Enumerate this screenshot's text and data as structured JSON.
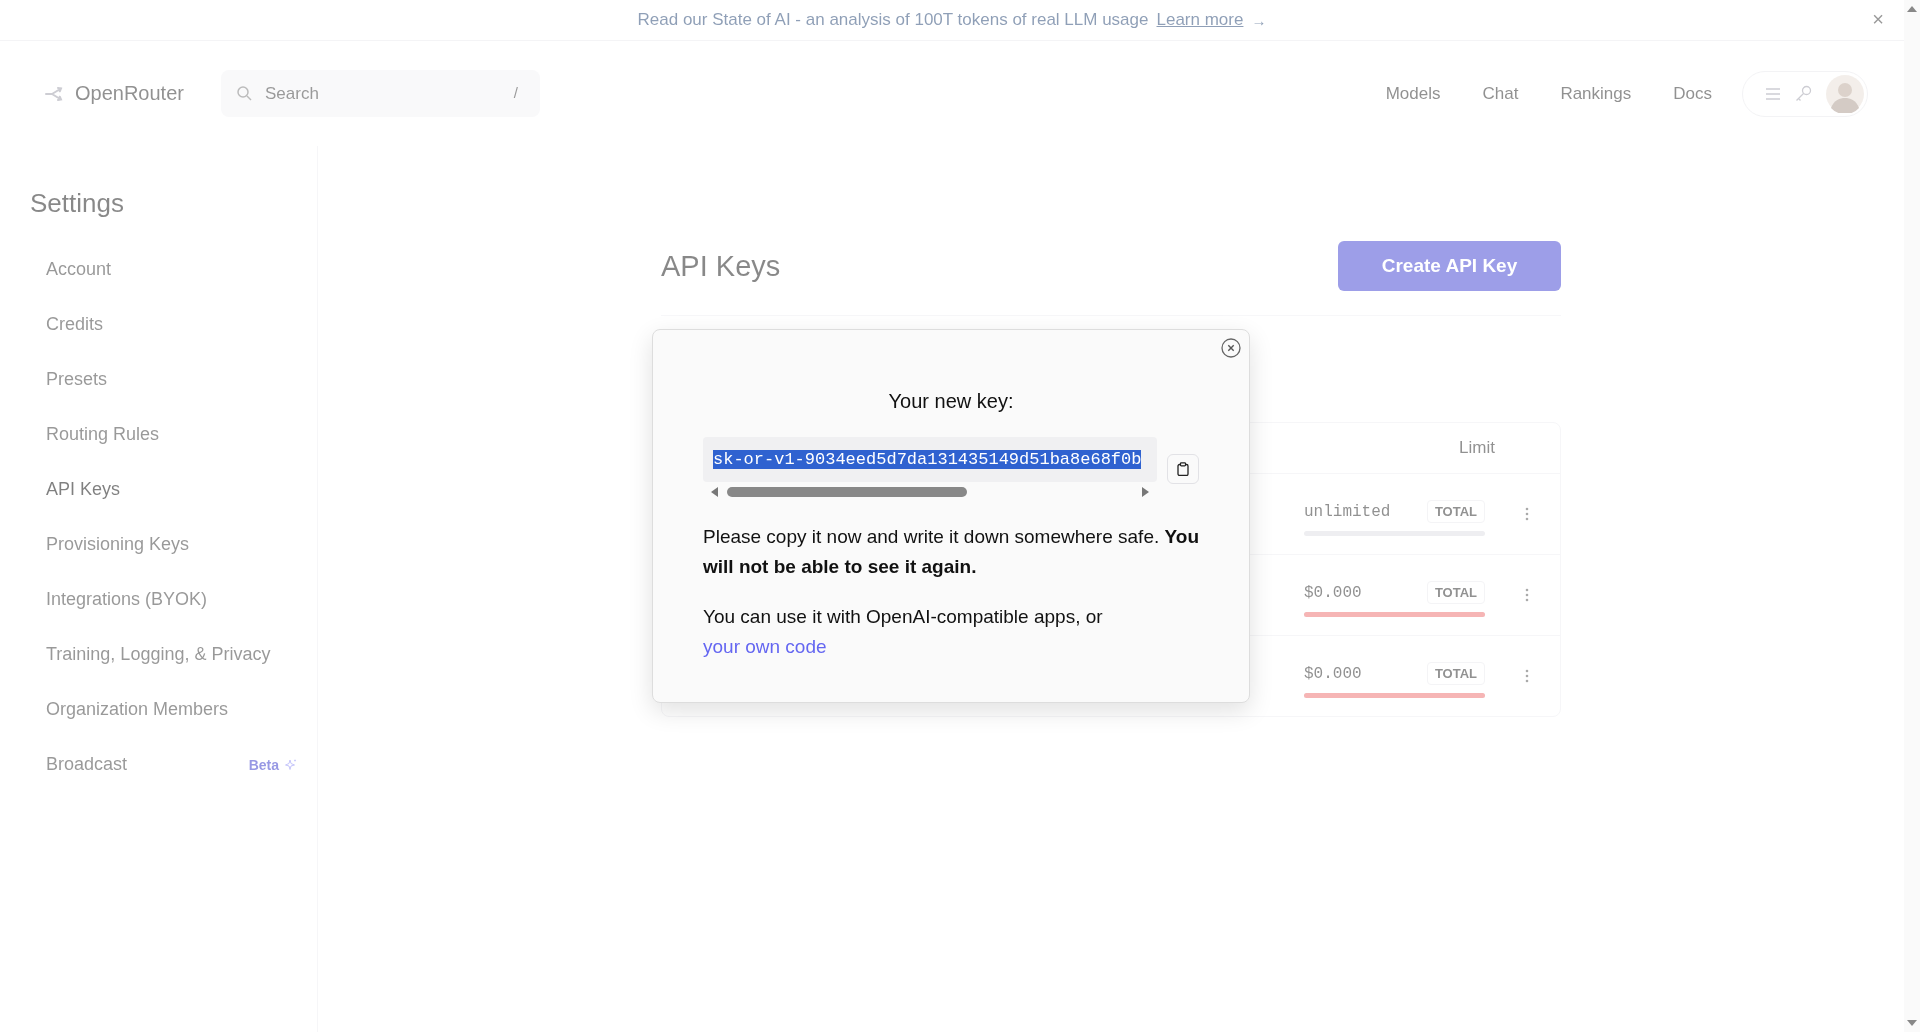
{
  "banner": {
    "text": "Read our State of AI - an analysis of 100T tokens of real LLM usage",
    "link": "Learn more",
    "arrow": "→",
    "close": "×"
  },
  "header": {
    "logo": "OpenRouter",
    "search": {
      "placeholder": "Search",
      "shortcut": "/"
    },
    "nav": [
      "Models",
      "Chat",
      "Rankings",
      "Docs"
    ]
  },
  "sidebar": {
    "title": "Settings",
    "items": [
      {
        "label": "Account",
        "selected": false
      },
      {
        "label": "Credits",
        "selected": false
      },
      {
        "label": "Presets",
        "selected": false
      },
      {
        "label": "Routing Rules",
        "selected": false
      },
      {
        "label": "API Keys",
        "selected": true
      },
      {
        "label": "Provisioning Keys",
        "selected": false
      },
      {
        "label": "Integrations (BYOK)",
        "selected": false
      },
      {
        "label": "Training, Logging, & Privacy",
        "selected": false
      },
      {
        "label": "Organization Members",
        "selected": false
      },
      {
        "label": "Broadcast",
        "selected": false,
        "badge": "Beta"
      }
    ]
  },
  "page": {
    "title": "API Keys",
    "create_button": "Create API Key"
  },
  "table": {
    "columns": [
      "Limit"
    ],
    "rows": [
      {
        "limit": "unlimited",
        "tag": "TOTAL",
        "level": 0
      },
      {
        "limit": "$0.000",
        "tag": "TOTAL",
        "level": 1
      },
      {
        "limit": "$0.000",
        "tag": "TOTAL",
        "level": 1
      }
    ]
  },
  "modal": {
    "title": "Your new key:",
    "key": {
      "value": "sk-or-v1-9034eed5d7da131435149d51ba8e68f0b",
      "selected": true
    },
    "warning": "Please copy it now and write it down somewhere safe. **You will not be able to see it again.**",
    "usage": "You can use it with OpenAI-compatible apps, or",
    "link": "your own code"
  }
}
